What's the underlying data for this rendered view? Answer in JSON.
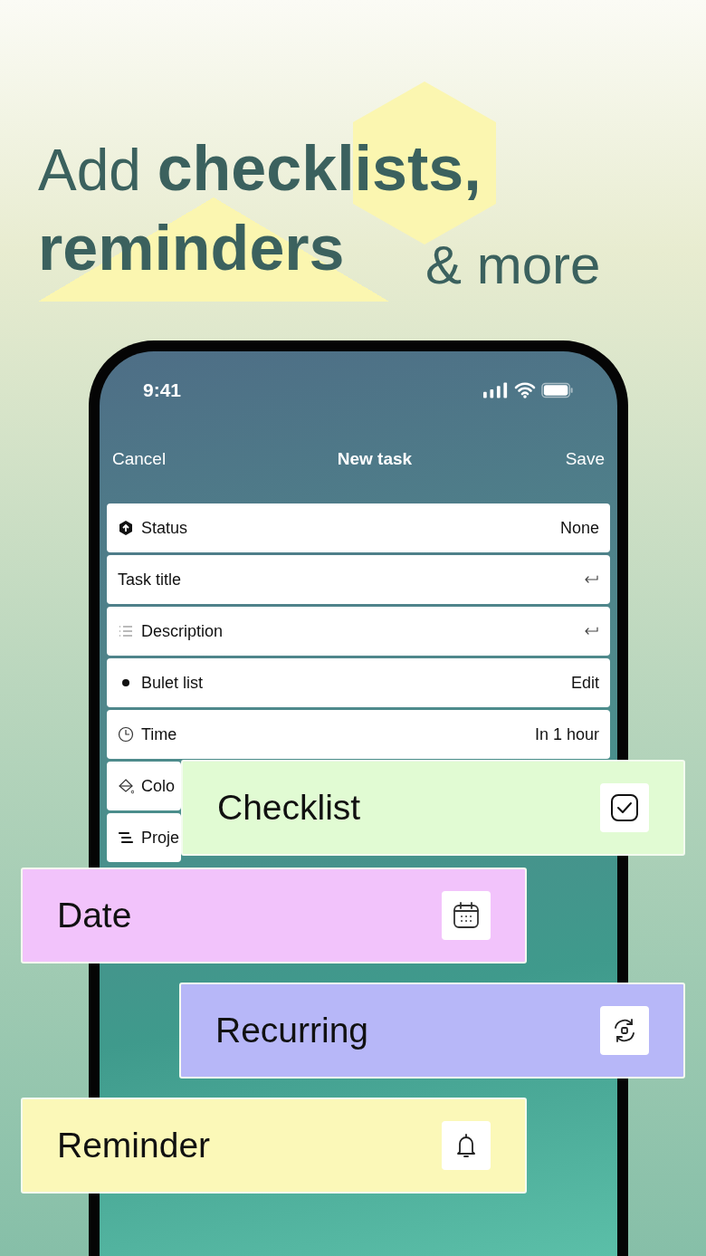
{
  "headline": {
    "line_1": "Add **checklists,**",
    "line_2": "reminders",
    "line_3": "& more"
  },
  "phone": {
    "status_bar": {
      "time": "9:41"
    },
    "nav": {
      "cancel": "Cancel",
      "title": "New task",
      "save": "Save"
    },
    "rows": [
      {
        "kind": "status",
        "label": "Status",
        "value": "None"
      },
      {
        "kind": "title",
        "label": "Task title"
      },
      {
        "kind": "description",
        "label": "Description"
      },
      {
        "kind": "bullets",
        "label": "Bulet list",
        "value": "Edit"
      },
      {
        "kind": "time",
        "label": "Time",
        "value": "In 1 hour"
      },
      {
        "kind": "color",
        "label": "Colo"
      },
      {
        "kind": "project",
        "label": "Proje"
      }
    ]
  },
  "feature_cards": [
    {
      "label": "Checklist",
      "kind": "checklist",
      "color": "#e1fbd3"
    },
    {
      "label": "Date",
      "kind": "date",
      "color": "#f2c3fb"
    },
    {
      "label": "Recurring",
      "kind": "recurring",
      "color": "#b7b7f8"
    },
    {
      "label": "Reminder",
      "kind": "reminder",
      "color": "#fbf8b8"
    }
  ]
}
